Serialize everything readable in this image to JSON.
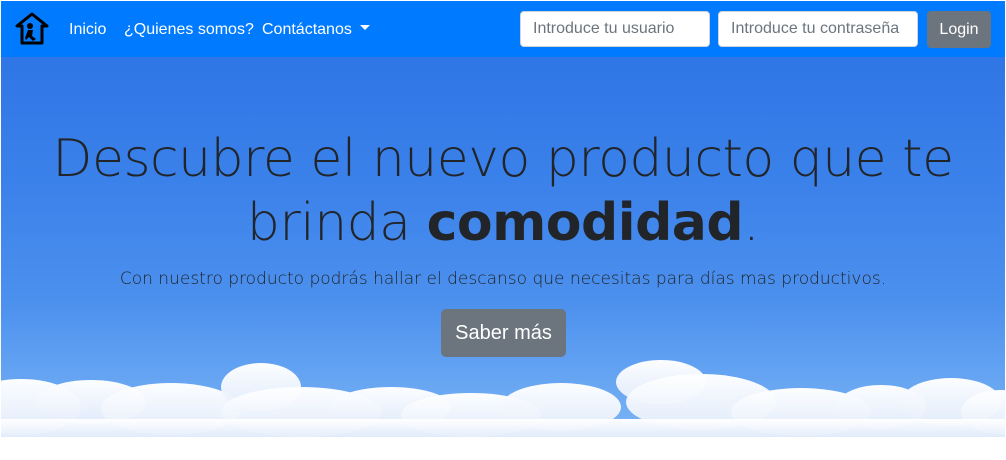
{
  "navbar": {
    "brand_icon": "house-person-icon",
    "links": [
      {
        "label": "Inicio"
      },
      {
        "label": "¿Quienes somos?"
      },
      {
        "label": "Contáctanos",
        "has_dropdown": true
      }
    ],
    "username_placeholder": "Introduce tu usuario",
    "password_placeholder": "Introduce tu contraseña",
    "login_label": "Login",
    "colors": {
      "navbar_bg": "#007bff",
      "button_bg": "#6c757d"
    }
  },
  "hero": {
    "headline_part1": "Descubre el nuevo producto que te brinda ",
    "headline_bold": "comodidad",
    "headline_end": ".",
    "subtitle": "Con nuestro producto podrás hallar el descanso que necesitas para días mas productivos.",
    "cta_label": "Saber más",
    "background": "sky-with-clouds"
  }
}
